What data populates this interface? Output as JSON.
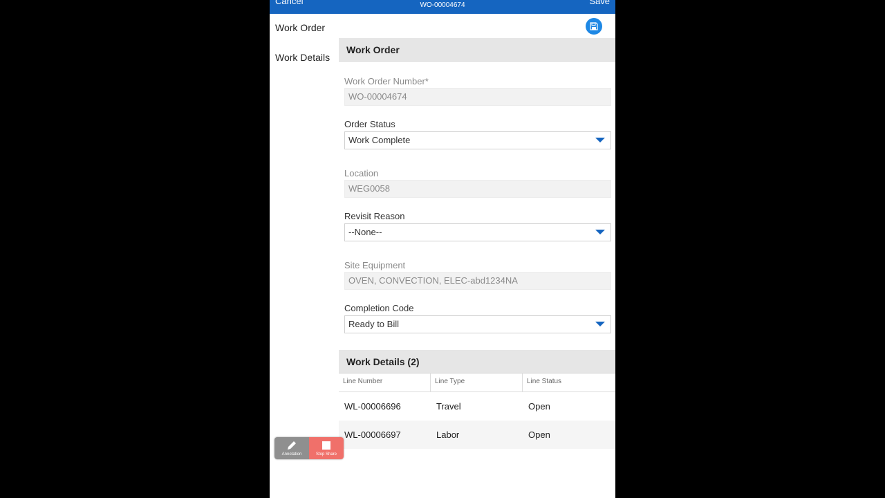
{
  "header": {
    "cancel_label": "Cancel",
    "title": "WO-00004674",
    "save_label": "Save"
  },
  "sidebar": {
    "items": [
      {
        "label": "Work Order"
      },
      {
        "label": "Work Details"
      }
    ]
  },
  "work_order": {
    "section_title": "Work Order",
    "fields": {
      "number": {
        "label": "Work Order Number*",
        "value": "WO-00004674"
      },
      "status": {
        "label": "Order Status",
        "value": "Work Complete"
      },
      "location": {
        "label": "Location",
        "value": "WEG0058"
      },
      "revisit": {
        "label": "Revisit Reason",
        "value": "--None--"
      },
      "equipment": {
        "label": "Site Equipment",
        "value": "OVEN, CONVECTION, ELEC-abd1234NA"
      },
      "completion": {
        "label": "Completion Code",
        "value": "Ready to Bill"
      }
    }
  },
  "work_details": {
    "section_title": "Work Details (2)",
    "columns": [
      "Line Number",
      "Line Type",
      "Line Status"
    ],
    "rows": [
      {
        "line_number": "WL-00006696",
        "line_type": "Travel",
        "line_status": "Open"
      },
      {
        "line_number": "WL-00006697",
        "line_type": "Labor",
        "line_status": "Open"
      }
    ]
  },
  "overlay": {
    "annotation_label": "Annotation",
    "stop_share_label": "Stop Share"
  },
  "colors": {
    "brand_blue": "#1565c0",
    "save_icon_blue": "#1e88e5",
    "stop_red": "#f0706a",
    "annotation_gray": "#8f8f8f"
  },
  "icons": {
    "save": "floppy-disk-icon",
    "annotation": "pencil-icon",
    "stop_share": "stop-square-icon",
    "dropdown": "caret-down-icon"
  }
}
